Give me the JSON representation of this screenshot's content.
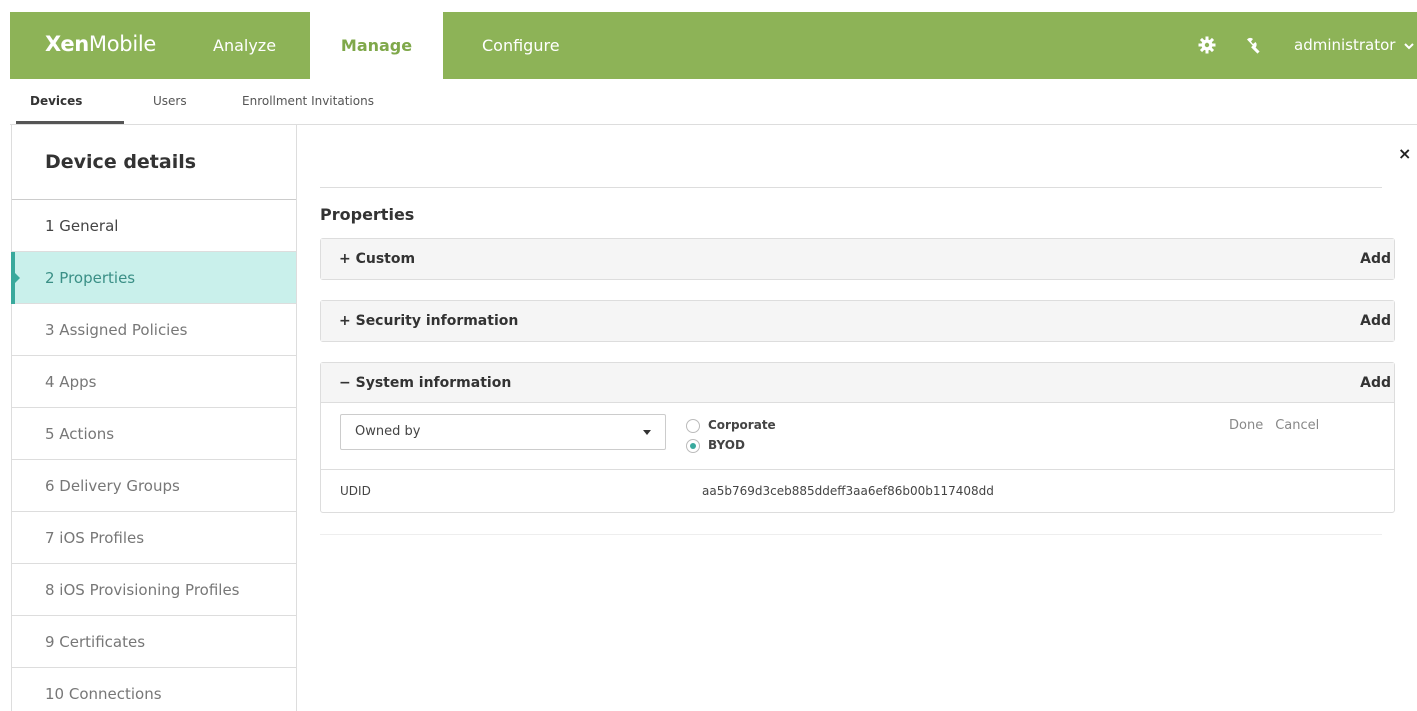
{
  "header": {
    "logo_bold": "Xen",
    "logo_light": "Mobile",
    "tabs": [
      "Analyze",
      "Manage",
      "Configure"
    ],
    "active_tab": "Manage",
    "gear_icon": "gear-icon",
    "wrench_icon": "wrench-icon",
    "user": "administrator",
    "accent_color": "#8db357"
  },
  "subnav": {
    "tabs": [
      "Devices",
      "Users",
      "Enrollment Invitations"
    ],
    "active": "Devices"
  },
  "sidebar": {
    "title": "Device details",
    "items": [
      {
        "label": "1  General"
      },
      {
        "label": "2  Properties"
      },
      {
        "label": "3  Assigned Policies"
      },
      {
        "label": "4  Apps"
      },
      {
        "label": "5  Actions"
      },
      {
        "label": "6  Delivery Groups"
      },
      {
        "label": "7  iOS Profiles"
      },
      {
        "label": "8  iOS Provisioning Profiles"
      },
      {
        "label": "9  Certificates"
      },
      {
        "label": "10  Connections"
      }
    ],
    "active_index": 1,
    "active_color": "#c9f0eb"
  },
  "main": {
    "close_label": "×",
    "section_title": "Properties",
    "panels": [
      {
        "title": "+ Custom",
        "add": "Add"
      },
      {
        "title": "+ Security information",
        "add": "Add"
      },
      {
        "title": "− System information",
        "add": "Add"
      }
    ],
    "editor": {
      "select_value": "Owned by",
      "options": [
        {
          "label": "Corporate",
          "checked": false
        },
        {
          "label": "BYOD",
          "checked": true
        }
      ],
      "done": "Done",
      "cancel": "Cancel"
    },
    "udid": {
      "label": "UDID",
      "value": "aa5b769d3ceb885ddeff3aa6ef86b00b117408dd"
    }
  }
}
